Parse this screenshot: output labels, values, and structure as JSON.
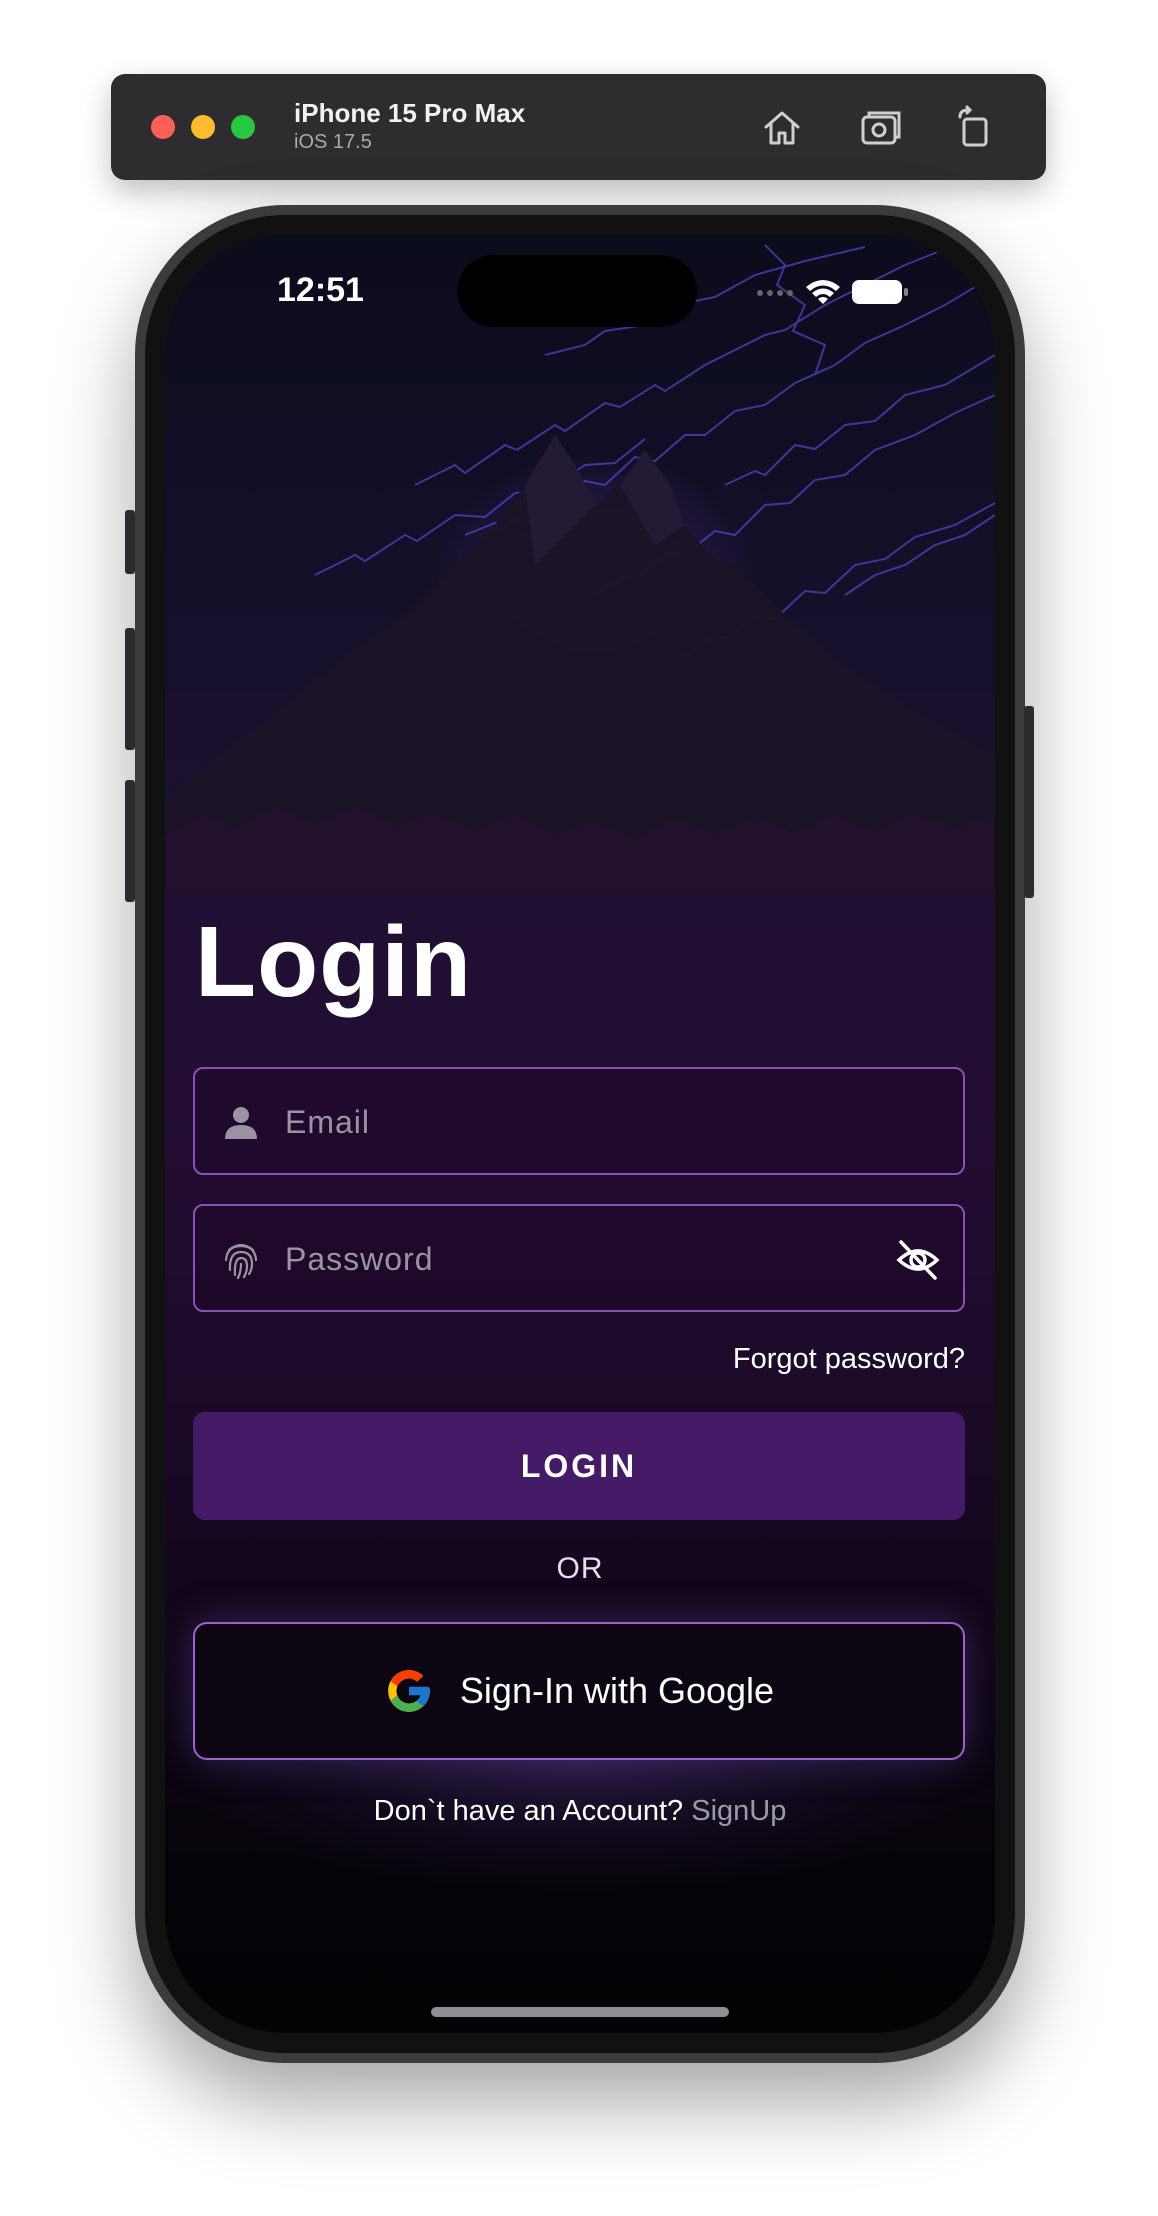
{
  "simulator": {
    "device_name": "iPhone 15 Pro Max",
    "os_version": "iOS 17.5",
    "toolbar_icons": [
      "home-icon",
      "screenshot-icon",
      "rotate-icon"
    ]
  },
  "status_bar": {
    "time": "12:51",
    "icons": [
      "cellular-icon",
      "wifi-icon",
      "battery-icon"
    ]
  },
  "login": {
    "title": "Login",
    "email": {
      "placeholder": "Email",
      "value": "",
      "icon": "person-icon"
    },
    "password": {
      "placeholder": "Password",
      "value": "",
      "icon": "fingerprint-icon",
      "toggle_icon": "eye-slash-icon"
    },
    "forgot_label": "Forgot password?",
    "submit_label": "LOGIN",
    "divider_label": "OR",
    "google_label": "Sign-In with Google",
    "signup_prompt": "Don`t have an Account?",
    "signup_link": "SignUp"
  },
  "colors": {
    "accent_border": "#8d4fb5",
    "login_button": "#451a66",
    "google_border": "#a15fce",
    "signup_link": "#9b9aa6"
  }
}
